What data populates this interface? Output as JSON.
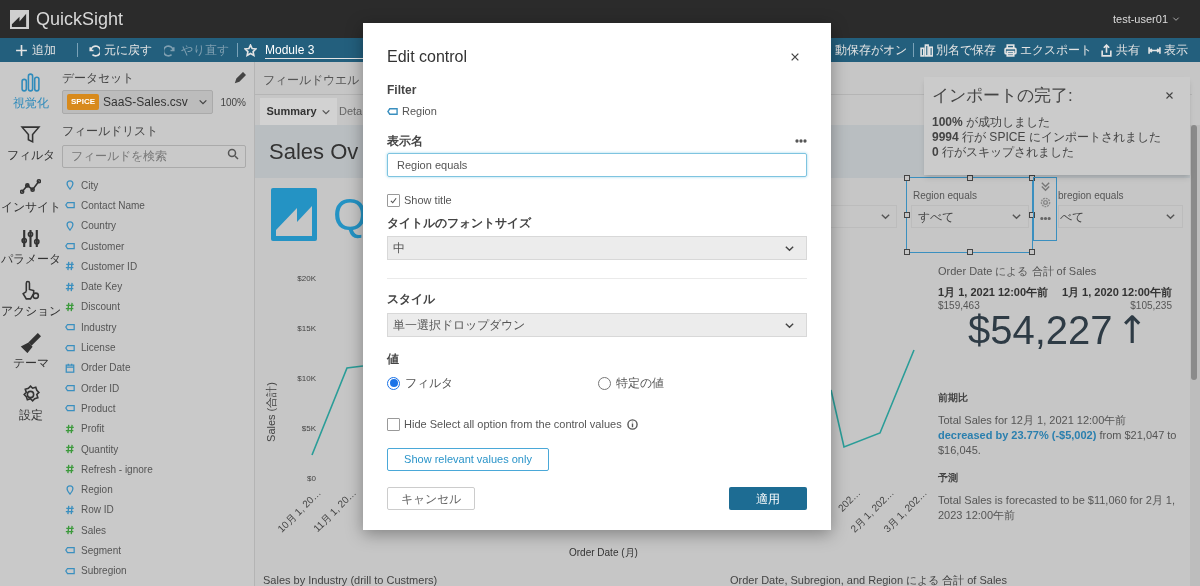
{
  "app": {
    "name": "QuickSight",
    "user": "test-user01"
  },
  "toolbar": {
    "left": [
      {
        "kind": "add",
        "label": "追加",
        "disabled": false
      },
      {
        "kind": "undo",
        "label": "元に戻す",
        "disabled": false
      },
      {
        "kind": "redo",
        "label": "やり直す",
        "disabled": true
      }
    ],
    "analysis_name": "Module 3",
    "right": [
      {
        "kind": "autosave",
        "label": "動保存がオン"
      },
      {
        "kind": "save_as",
        "label": "別名で保存"
      },
      {
        "kind": "export",
        "label": "エクスポート"
      },
      {
        "kind": "share",
        "label": "共有"
      },
      {
        "kind": "view",
        "label": "表示"
      }
    ]
  },
  "nav": [
    {
      "kind": "visualize",
      "label": "視覚化",
      "selected": true
    },
    {
      "kind": "filter",
      "label": "フィルタ",
      "selected": false
    },
    {
      "kind": "insight",
      "label": "インサイト",
      "selected": false
    },
    {
      "kind": "parameter",
      "label": "パラメータ",
      "selected": false
    },
    {
      "kind": "action",
      "label": "アクション",
      "selected": false
    },
    {
      "kind": "theme",
      "label": "テーマ",
      "selected": false
    },
    {
      "kind": "settings",
      "label": "設定",
      "selected": false
    }
  ],
  "dataset_panel": {
    "title": "データセット",
    "source_badge": "SPICE",
    "dataset": "SaaS-Sales.csv",
    "percent": "100%",
    "field_list_title": "フィールドリスト",
    "search": {
      "placeholder": "フィールドを検索"
    },
    "fields": [
      {
        "name": "City",
        "kind": "geo"
      },
      {
        "name": "Contact Name",
        "kind": "text"
      },
      {
        "name": "Country",
        "kind": "geo"
      },
      {
        "name": "Customer",
        "kind": "text"
      },
      {
        "name": "Customer ID",
        "kind": "number"
      },
      {
        "name": "Date Key",
        "kind": "number"
      },
      {
        "name": "Discount",
        "kind": "measure"
      },
      {
        "name": "Industry",
        "kind": "text"
      },
      {
        "name": "License",
        "kind": "text"
      },
      {
        "name": "Order Date",
        "kind": "date"
      },
      {
        "name": "Order ID",
        "kind": "text"
      },
      {
        "name": "Product",
        "kind": "text"
      },
      {
        "name": "Profit",
        "kind": "measure"
      },
      {
        "name": "Quantity",
        "kind": "measure"
      },
      {
        "name": "Refresh - ignore",
        "kind": "measure"
      },
      {
        "name": "Region",
        "kind": "geo"
      },
      {
        "name": "Row ID",
        "kind": "number"
      },
      {
        "name": "Sales",
        "kind": "measure"
      },
      {
        "name": "Segment",
        "kind": "text"
      },
      {
        "name": "Subregion",
        "kind": "text"
      }
    ]
  },
  "canvas": {
    "field_wells": "フィールドウエル",
    "sheets": [
      {
        "label": "Summary",
        "selected": true
      },
      {
        "label": "Deta",
        "selected": false
      }
    ],
    "title": "Sales Ov",
    "logo_text": "Q",
    "line_chart": {
      "ylabel": "Sales (合計)",
      "yticks": [
        "$20K",
        "$15K",
        "$10K",
        "$5K",
        "$0"
      ],
      "xticks_left": [
        "10月 1, 20…",
        "11月 1, 20…"
      ],
      "xticks_right": [
        "202…",
        "2月 1, 202…",
        "3月 1, 202…"
      ],
      "xlabel": "Order Date (月)"
    },
    "selected_control": {
      "title": "Region equals",
      "value": "すべて"
    },
    "next_control": {
      "title": "bregion equals",
      "value": "べて"
    },
    "kpi": {
      "title": "Order Date による 合計 of Sales",
      "current_date": "1月 1, 2021 12:00午前",
      "current_value": "$159,463",
      "previous_date": "1月 1, 2020 12:00午前",
      "previous_value": "$105,235",
      "difference": "$54,227",
      "trend": "↑"
    },
    "insights": [
      {
        "title": "前期比",
        "text": "Total Sales for 12月 1, 2021 12:00午前 **decreased by 23.77% (-$5,002)** from $21,047 to $16,045."
      },
      {
        "title": "予測",
        "text": "Total Sales is forecasted to be $11,060 for 2月 1, 2023 12:00午前"
      }
    ],
    "bottom_titles": [
      "Sales by Industry (drill to Custmers)",
      "Order Date, Subregion, and Region による 合計 of Sales"
    ]
  },
  "toast": {
    "title": "インポートの完了:",
    "lines": [
      "**100%** が成功しました",
      "**9994** 行が SPICE にインポートされました",
      "**0** 行がスキップされました"
    ]
  },
  "modal": {
    "title": "Edit control",
    "filter_label": "Filter",
    "filter_field": "Region",
    "display_name_label": "表示名",
    "display_name": "Region equals",
    "show_title": {
      "label": "Show title",
      "checked": true
    },
    "font_size_label": "タイトルのフォントサイズ",
    "font_size": "中",
    "style_label": "スタイル",
    "style": "単一選択ドロップダウン",
    "values_label": "値",
    "value_options": [
      {
        "label": "フィルタ",
        "selected": true
      },
      {
        "label": "特定の値",
        "selected": false
      }
    ],
    "hide_select_all": {
      "label": "Hide Select all option from the control values",
      "checked": false
    },
    "relevant_button": "Show relevant values only",
    "cancel": "キャンセル",
    "apply": "適用"
  }
}
